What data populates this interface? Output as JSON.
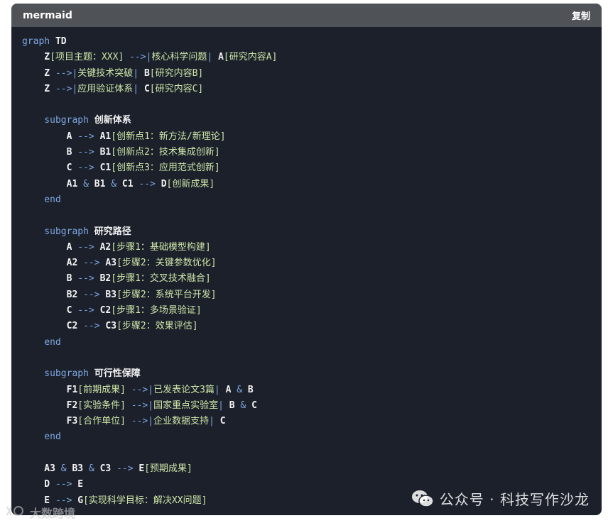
{
  "header": {
    "language": "mermaid",
    "copy_label": "复制"
  },
  "code_lines": [
    [
      [
        "kw",
        "graph "
      ],
      [
        "tx",
        "TD"
      ]
    ],
    [
      [
        "tx",
        "    Z"
      ],
      [
        "st",
        "[项目主题：XXX] "
      ],
      [
        "op",
        "-->|"
      ],
      [
        "st",
        "核心科学问题"
      ],
      [
        "op",
        "| "
      ],
      [
        "tx",
        "A"
      ],
      [
        "st",
        "[研究内容A]"
      ]
    ],
    [
      [
        "tx",
        "    Z "
      ],
      [
        "op",
        "-->|"
      ],
      [
        "st",
        "关键技术突破"
      ],
      [
        "op",
        "| "
      ],
      [
        "tx",
        "B"
      ],
      [
        "st",
        "[研究内容B]"
      ]
    ],
    [
      [
        "tx",
        "    Z "
      ],
      [
        "op",
        "-->|"
      ],
      [
        "st",
        "应用验证体系"
      ],
      [
        "op",
        "| "
      ],
      [
        "tx",
        "C"
      ],
      [
        "st",
        "[研究内容C]"
      ]
    ],
    [],
    [
      [
        "kw",
        "    subgraph "
      ],
      [
        "tx",
        "创新体系"
      ]
    ],
    [
      [
        "tx",
        "        A "
      ],
      [
        "op",
        "--> "
      ],
      [
        "tx",
        "A1"
      ],
      [
        "st",
        "[创新点1：新方法/新理论]"
      ]
    ],
    [
      [
        "tx",
        "        B "
      ],
      [
        "op",
        "--> "
      ],
      [
        "tx",
        "B1"
      ],
      [
        "st",
        "[创新点2：技术集成创新]"
      ]
    ],
    [
      [
        "tx",
        "        C "
      ],
      [
        "op",
        "--> "
      ],
      [
        "tx",
        "C1"
      ],
      [
        "st",
        "[创新点3：应用范式创新]"
      ]
    ],
    [
      [
        "tx",
        "        A1 "
      ],
      [
        "op",
        "& "
      ],
      [
        "tx",
        "B1 "
      ],
      [
        "op",
        "& "
      ],
      [
        "tx",
        "C1 "
      ],
      [
        "op",
        "--> "
      ],
      [
        "tx",
        "D"
      ],
      [
        "st",
        "[创新成果]"
      ]
    ],
    [
      [
        "kw",
        "    end"
      ]
    ],
    [],
    [
      [
        "kw",
        "    subgraph "
      ],
      [
        "tx",
        "研究路径"
      ]
    ],
    [
      [
        "tx",
        "        A "
      ],
      [
        "op",
        "--> "
      ],
      [
        "tx",
        "A2"
      ],
      [
        "st",
        "[步骤1：基础模型构建]"
      ]
    ],
    [
      [
        "tx",
        "        A2 "
      ],
      [
        "op",
        "--> "
      ],
      [
        "tx",
        "A3"
      ],
      [
        "st",
        "[步骤2：关键参数优化]"
      ]
    ],
    [
      [
        "tx",
        "        B "
      ],
      [
        "op",
        "--> "
      ],
      [
        "tx",
        "B2"
      ],
      [
        "st",
        "[步骤1：交叉技术融合]"
      ]
    ],
    [
      [
        "tx",
        "        B2 "
      ],
      [
        "op",
        "--> "
      ],
      [
        "tx",
        "B3"
      ],
      [
        "st",
        "[步骤2：系统平台开发]"
      ]
    ],
    [
      [
        "tx",
        "        C "
      ],
      [
        "op",
        "--> "
      ],
      [
        "tx",
        "C2"
      ],
      [
        "st",
        "[步骤1：多场景验证]"
      ]
    ],
    [
      [
        "tx",
        "        C2 "
      ],
      [
        "op",
        "--> "
      ],
      [
        "tx",
        "C3"
      ],
      [
        "st",
        "[步骤2：效果评估]"
      ]
    ],
    [
      [
        "kw",
        "    end"
      ]
    ],
    [],
    [
      [
        "kw",
        "    subgraph "
      ],
      [
        "tx",
        "可行性保障"
      ]
    ],
    [
      [
        "tx",
        "        F1"
      ],
      [
        "st",
        "[前期成果] "
      ],
      [
        "op",
        "-->|"
      ],
      [
        "st",
        "已发表论文3篇"
      ],
      [
        "op",
        "| "
      ],
      [
        "tx",
        "A "
      ],
      [
        "op",
        "& "
      ],
      [
        "tx",
        "B"
      ]
    ],
    [
      [
        "tx",
        "        F2"
      ],
      [
        "st",
        "[实验条件] "
      ],
      [
        "op",
        "-->|"
      ],
      [
        "st",
        "国家重点实验室"
      ],
      [
        "op",
        "| "
      ],
      [
        "tx",
        "B "
      ],
      [
        "op",
        "& "
      ],
      [
        "tx",
        "C"
      ]
    ],
    [
      [
        "tx",
        "        F3"
      ],
      [
        "st",
        "[合作单位] "
      ],
      [
        "op",
        "-->|"
      ],
      [
        "st",
        "企业数据支持"
      ],
      [
        "op",
        "| "
      ],
      [
        "tx",
        "C"
      ]
    ],
    [
      [
        "kw",
        "    end"
      ]
    ],
    [],
    [
      [
        "tx",
        "    A3 "
      ],
      [
        "op",
        "& "
      ],
      [
        "tx",
        "B3 "
      ],
      [
        "op",
        "& "
      ],
      [
        "tx",
        "C3 "
      ],
      [
        "op",
        "--> "
      ],
      [
        "tx",
        "E"
      ],
      [
        "st",
        "[预期成果]"
      ]
    ],
    [
      [
        "tx",
        "    D "
      ],
      [
        "op",
        "--> "
      ],
      [
        "tx",
        "E"
      ]
    ],
    [
      [
        "tx",
        "    E "
      ],
      [
        "op",
        "--> "
      ],
      [
        "tx",
        "G"
      ],
      [
        "st",
        "[实现科学目标：解决XX问题]"
      ]
    ]
  ],
  "watermark": {
    "text": "公众号 · 科技写作沙龙",
    "icon": "wechat-icon"
  },
  "watermark2": {
    "text": "大数跨境"
  },
  "colors": {
    "code_bg": "#1b202b",
    "header_bg": "#4f5257",
    "keyword": "#7ea6e0",
    "string": "#cfe6a8"
  }
}
